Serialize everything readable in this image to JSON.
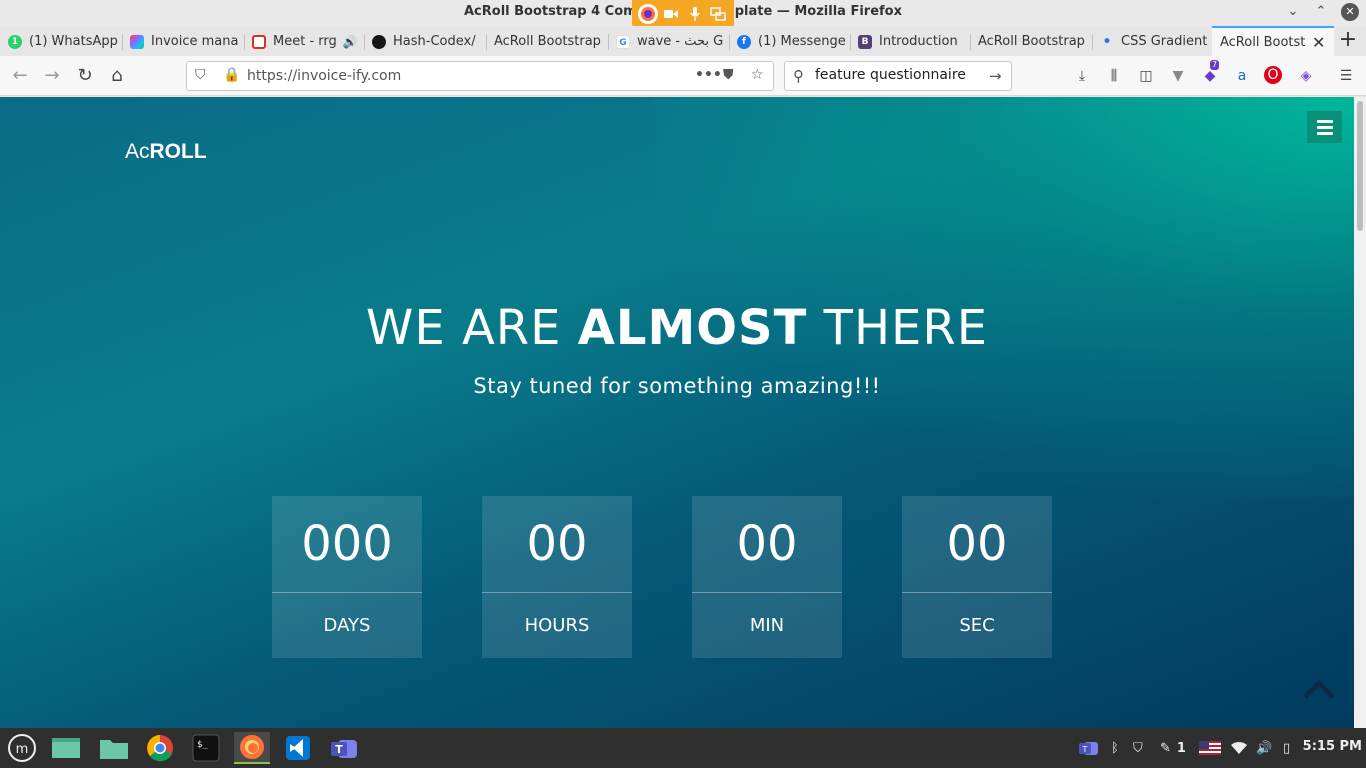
{
  "window": {
    "title": "AcRoll Bootstrap 4 Coming Soon Template — Mozilla Firefox",
    "minimize": "⌄",
    "maximize": "⌃",
    "close": "✕"
  },
  "tabs": [
    {
      "label": "(1) WhatsApp",
      "favicon_color": "#25d366",
      "favicon_text": "1"
    },
    {
      "label": "Invoice mana",
      "favicon_color": "#1e1e1e",
      "favicon_text": ""
    },
    {
      "label": "Meet - rrg",
      "favicon_color": "#d93025",
      "favicon_text": ""
    },
    {
      "label": "Hash-Codex/",
      "favicon_color": "#181717",
      "favicon_text": ""
    },
    {
      "label": "AcRoll Bootstrap",
      "favicon_color": "",
      "favicon_text": ""
    },
    {
      "label": "wave - بحث G",
      "favicon_color": "#ffffff",
      "favicon_text": "G"
    },
    {
      "label": "(1) Messenge",
      "favicon_color": "#1877f2",
      "favicon_text": "f"
    },
    {
      "label": "Introduction",
      "favicon_color": "#563d7c",
      "favicon_text": "B"
    },
    {
      "label": "AcRoll Bootstrap",
      "favicon_color": "",
      "favicon_text": ""
    },
    {
      "label": "CSS Gradient",
      "favicon_color": "",
      "favicon_text": "•"
    },
    {
      "label": "AcRoll Bootst",
      "favicon_color": "",
      "favicon_text": "",
      "active": true
    }
  ],
  "new_tab": "+",
  "nav": {
    "url": "https://invoice-ify.com",
    "search_value": "feature questionnaire",
    "extension_badge": "7"
  },
  "page": {
    "brand_light": "Ac",
    "brand_bold": "ROLL",
    "headline_pre": "WE ARE ",
    "headline_bold": "ALMOST",
    "headline_post": " THERE",
    "tagline": "Stay tuned for something amazing!!!",
    "countdown": [
      {
        "value": "000",
        "unit": "DAYS"
      },
      {
        "value": "00",
        "unit": "HOURS"
      },
      {
        "value": "00",
        "unit": "MIN"
      },
      {
        "value": "00",
        "unit": "SEC"
      }
    ]
  },
  "taskbar": {
    "clock": "5:15 PM",
    "tray_count": "1"
  },
  "colors": {
    "accent": "#0a8f78",
    "page_gradient_start": "#087c8b",
    "page_gradient_end": "#023a5e",
    "share_indicator": "#f5a623"
  }
}
